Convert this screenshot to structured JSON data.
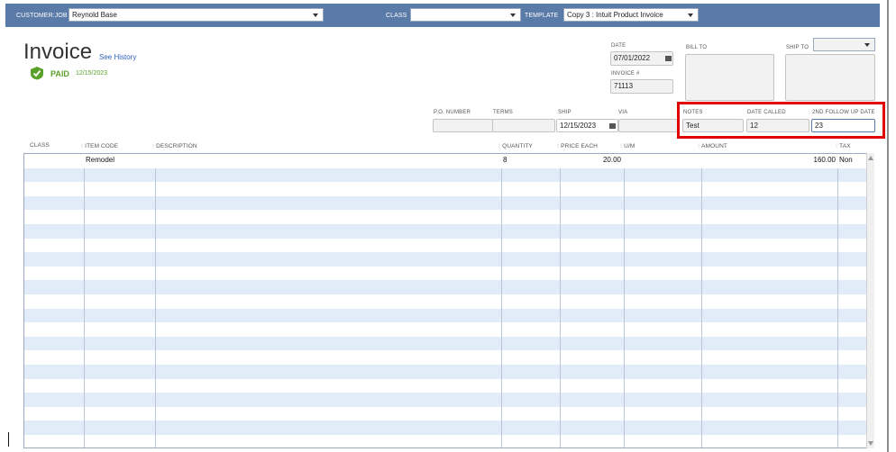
{
  "topbar": {
    "customer_job_label": "CUSTOMER:JOB",
    "customer_job_value": "Reynold Base",
    "class_label": "CLASS",
    "class_value": "",
    "template_label": "TEMPLATE",
    "template_value": "Copy 3 : Intuit Product Invoice"
  },
  "header": {
    "title": "Invoice",
    "see_history": "See History",
    "paid_label": "PAID",
    "paid_date": "12/15/2023"
  },
  "fields": {
    "date_label": "DATE",
    "date_value": "07/01/2022",
    "invoice_label": "INVOICE #",
    "invoice_value": "71113",
    "bill_to_label": "BILL TO",
    "ship_to_label": "SHIP TO",
    "po_label": "P.O. NUMBER",
    "po_value": "",
    "terms_label": "TERMS",
    "terms_value": "",
    "ship_label": "SHIP",
    "ship_value": "12/15/2023",
    "via_label": "VIA",
    "via_value": "",
    "notes_label": "NOTES",
    "notes_value": "Test",
    "date_called_label": "DATE CALLED",
    "date_called_value": "12",
    "followup_label": "2ND FOLLOW UP DATE",
    "followup_value": "23"
  },
  "table": {
    "columns": {
      "class": "CLASS",
      "item_code": "ITEM CODE",
      "description": "DESCRIPTION",
      "quantity": "QUANTITY",
      "price_each": "PRICE EACH",
      "um": "U/M",
      "amount": "AMOUNT",
      "tax": "TAX"
    },
    "rows": [
      {
        "class": "",
        "item_code": "Remodel",
        "description": "",
        "quantity": "8",
        "price_each": "20.00",
        "um": "",
        "amount": "160.00",
        "tax": "Non"
      }
    ]
  },
  "colors": {
    "topbar": "#5a7aa8",
    "row_alt": "#e2ecf8",
    "paid_green": "#5aa12b",
    "link_blue": "#2f62b8",
    "highlight_red": "#e00000"
  },
  "icons": [
    "dropdown-arrow-icon",
    "calendar-icon",
    "paid-check-icon",
    "scroll-up-icon",
    "scroll-down-icon"
  ]
}
